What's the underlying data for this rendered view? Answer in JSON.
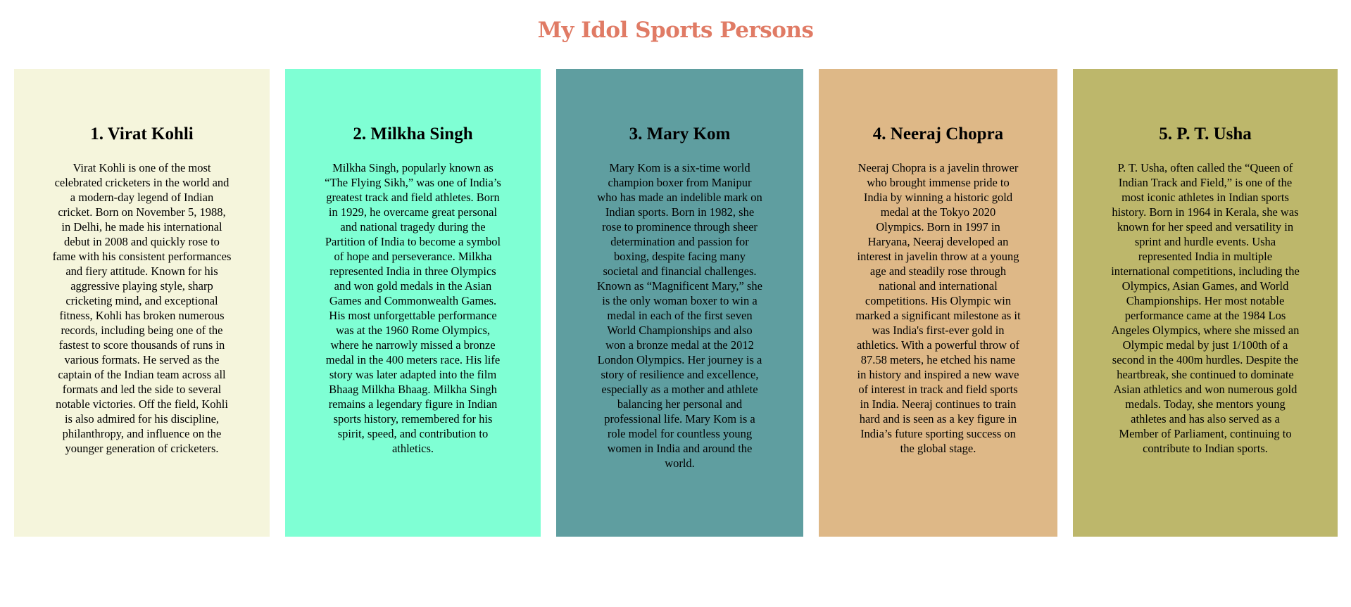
{
  "page": {
    "title": "My Idol Sports Persons"
  },
  "cards": [
    {
      "heading": "1. Virat Kohli",
      "bg_color": "#f5f5dc",
      "text": "Virat Kohli is one of the most celebrated cricketers in the world and a modern-day legend of Indian cricket. Born on November 5, 1988, in Delhi, he made his international debut in 2008 and quickly rose to fame with his consistent performances and fiery attitude. Known for his aggressive playing style, sharp cricketing mind, and exceptional fitness, Kohli has broken numerous records, including being one of the fastest to score thousands of runs in various formats. He served as the captain of the Indian team across all formats and led the side to several notable victories. Off the field, Kohli is also admired for his discipline, philanthropy, and influence on the younger generation of cricketers."
    },
    {
      "heading": "2. Milkha Singh",
      "bg_color": "#7fffd4",
      "text": "Milkha Singh, popularly known as “The Flying Sikh,” was one of India’s greatest track and field athletes. Born in 1929, he overcame great personal and national tragedy during the Partition of India to become a symbol of hope and perseverance. Milkha represented India in three Olympics and won gold medals in the Asian Games and Commonwealth Games. His most unforgettable performance was at the 1960 Rome Olympics, where he narrowly missed a bronze medal in the 400 meters race. His life story was later adapted into the film Bhaag Milkha Bhaag. Milkha Singh remains a legendary figure in Indian sports history, remembered for his spirit, speed, and contribution to athletics."
    },
    {
      "heading": "3. Mary Kom",
      "bg_color": "#5f9ea0",
      "text": "Mary Kom is a six-time world champion boxer from Manipur who has made an indelible mark on Indian sports. Born in 1982, she rose to prominence through sheer determination and passion for boxing, despite facing many societal and financial challenges. Known as “Magnificent Mary,” she is the only woman boxer to win a medal in each of the first seven World Championships and also won a bronze medal at the 2012 London Olympics. Her journey is a story of resilience and excellence, especially as a mother and athlete balancing her personal and professional life. Mary Kom is a role model for countless young women in India and around the world."
    },
    {
      "heading": "4. Neeraj Chopra",
      "bg_color": "#deb887",
      "text": "Neeraj Chopra is a javelin thrower who brought immense pride to India by winning a historic gold medal at the Tokyo 2020 Olympics. Born in 1997 in Haryana, Neeraj developed an interest in javelin throw at a young age and steadily rose through national and international competitions. His Olympic win marked a significant milestone as it was India's first-ever gold in athletics. With a powerful throw of 87.58 meters, he etched his name in history and inspired a new wave of interest in track and field sports in India. Neeraj continues to train hard and is seen as a key figure in India’s future sporting success on the global stage."
    },
    {
      "heading": "5. P. T. Usha",
      "bg_color": "#bdb76b",
      "text": "P. T. Usha, often called the “Queen of Indian Track and Field,” is one of the most iconic athletes in Indian sports history. Born in 1964 in Kerala, she was known for her speed and versatility in sprint and hurdle events. Usha represented India in multiple international competitions, including the Olympics, Asian Games, and World Championships. Her most notable performance came at the 1984 Los Angeles Olympics, where she missed an Olympic medal by just 1/100th of a second in the 400m hurdles. Despite the heartbreak, she continued to dominate Asian athletics and won numerous gold medals. Today, she mentors young athletes and has also served as a Member of Parliament, continuing to contribute to Indian sports."
    }
  ]
}
